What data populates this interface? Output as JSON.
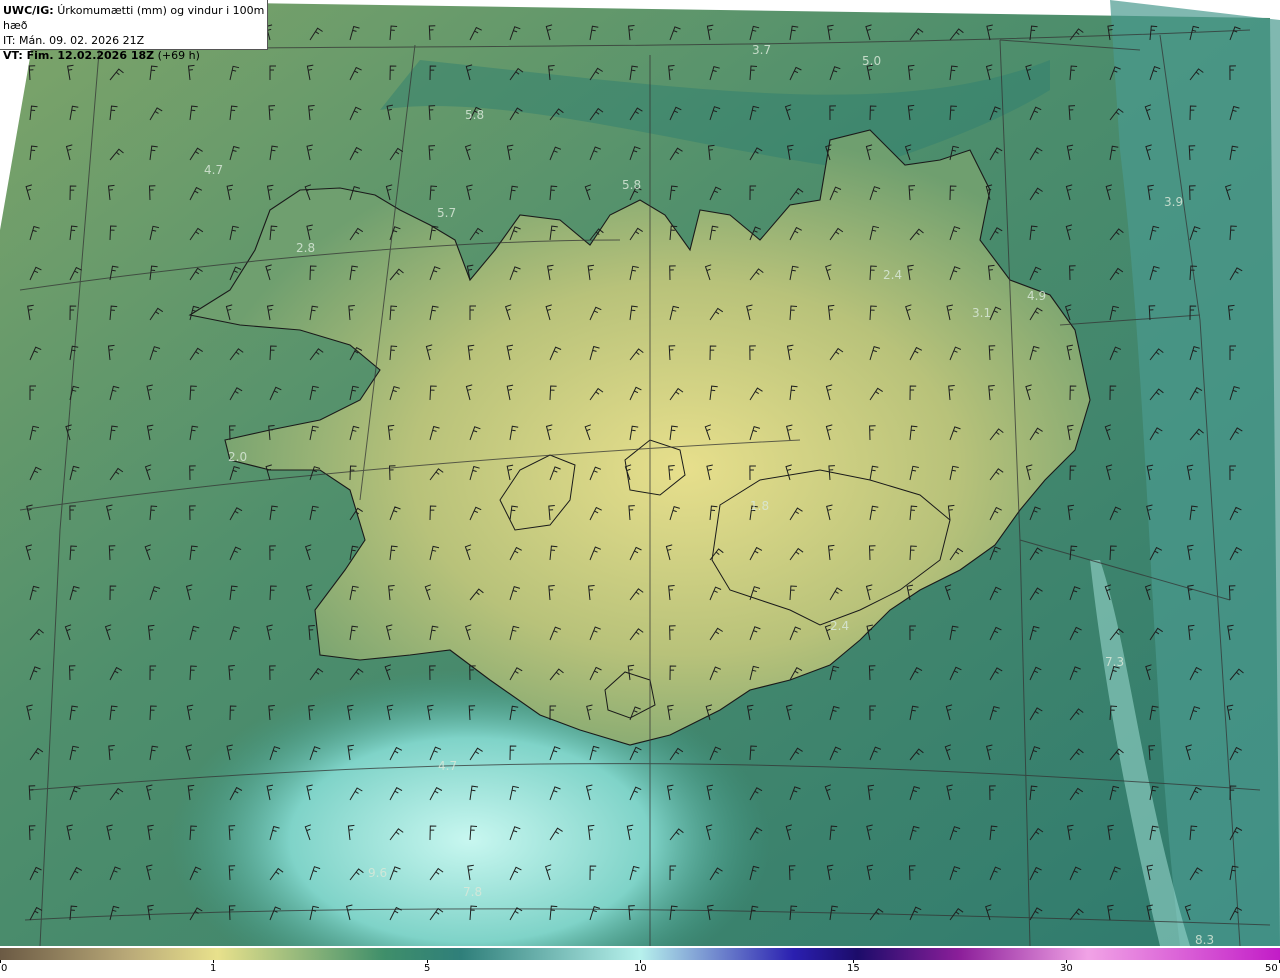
{
  "header": {
    "product": "UWC/IG:",
    "title": "Úrkomumætti (mm) og vindur i 100m hæð",
    "init_time": "IT: Mán. 09. 02. 2026 21Z",
    "valid_label": "VT: Fim. 12.02.2026 18Z",
    "lead": "(+69 h)"
  },
  "map_labels": [
    {
      "text": "3.7"
    },
    {
      "text": "5.0"
    },
    {
      "text": "5.8"
    },
    {
      "text": "4.7"
    },
    {
      "text": "5.8"
    },
    {
      "text": "5.7"
    },
    {
      "text": "3.9"
    },
    {
      "text": "2.8"
    },
    {
      "text": "2.4"
    },
    {
      "text": "4.9"
    },
    {
      "text": "3.1"
    },
    {
      "text": "2.0"
    },
    {
      "text": "7.3"
    },
    {
      "text": "4.7"
    },
    {
      "text": "9.6"
    },
    {
      "text": "7.8"
    },
    {
      "text": "8.3"
    },
    {
      "text": "2.4"
    },
    {
      "text": "1.8"
    }
  ],
  "colorbar": {
    "ticks": [
      "0",
      "1",
      "5",
      "10",
      "15",
      "30",
      "50"
    ],
    "colors": {
      "brown": "#6b5a44",
      "tan": "#b9a978",
      "yellow": "#e8e18c",
      "green": "#3f8f6a",
      "teal": "#2f7f7a",
      "cyan": "#b7f1ec",
      "blue": "#2a1fb0",
      "navy": "#1c0c6a",
      "purple": "#8c1f9a",
      "pink": "#f1a3e6",
      "magenta": "#c21cc7"
    }
  }
}
